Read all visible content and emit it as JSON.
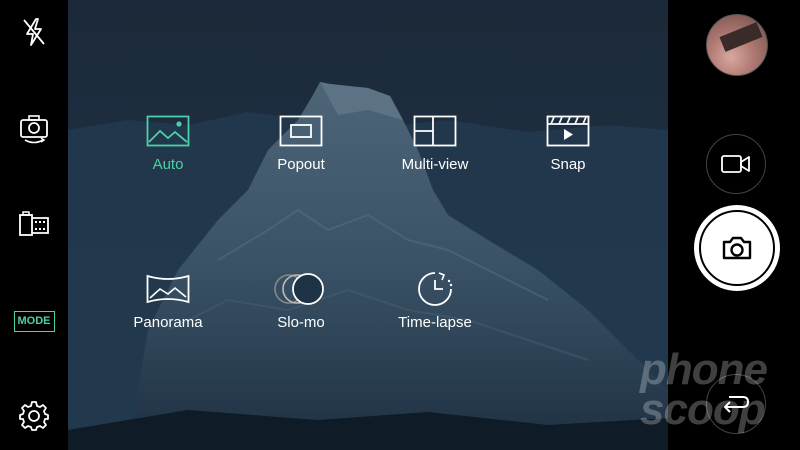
{
  "left_bar": {
    "flash_icon": "flash-off-icon",
    "switch_camera_icon": "switch-camera-icon",
    "gallery_icon": "film-roll-icon",
    "mode_label": "MODE",
    "settings_icon": "gear-icon"
  },
  "modes": [
    {
      "label": "Auto",
      "icon": "landscape-icon",
      "selected": true
    },
    {
      "label": "Popout",
      "icon": "popout-icon",
      "selected": false
    },
    {
      "label": "Multi-view",
      "icon": "multi-view-icon",
      "selected": false
    },
    {
      "label": "Snap",
      "icon": "clapperboard-icon",
      "selected": false
    },
    {
      "label": "Panorama",
      "icon": "panorama-icon",
      "selected": false
    },
    {
      "label": "Slo-mo",
      "icon": "slo-mo-icon",
      "selected": false
    },
    {
      "label": "Time-lapse",
      "icon": "time-lapse-icon",
      "selected": false
    }
  ],
  "help_label": "?",
  "watermark": [
    "phone",
    "scoop"
  ],
  "colors": {
    "accent": "#4dd0a6",
    "background": "#000000"
  }
}
